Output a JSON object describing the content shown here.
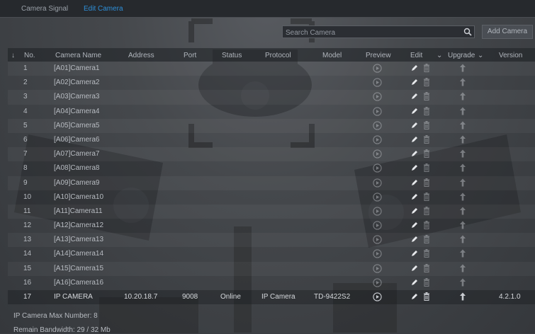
{
  "tabs": [
    {
      "label": "Camera Signal",
      "active": false
    },
    {
      "label": "Edit Camera",
      "active": true
    }
  ],
  "search": {
    "placeholder": "Search Camera"
  },
  "add_button": "Add Camera",
  "columns": {
    "sort": "↓",
    "no": "No.",
    "name": "Camera Name",
    "address": "Address",
    "port": "Port",
    "status": "Status",
    "protocol": "Protocol",
    "model": "Model",
    "preview": "Preview",
    "edit": "Edit",
    "upgrade": "Upgrade",
    "version": "Version"
  },
  "rows": [
    {
      "no": "1",
      "name": "[A01]Camera1"
    },
    {
      "no": "2",
      "name": "[A02]Camera2"
    },
    {
      "no": "3",
      "name": "[A03]Camera3"
    },
    {
      "no": "4",
      "name": "[A04]Camera4"
    },
    {
      "no": "5",
      "name": "[A05]Camera5"
    },
    {
      "no": "6",
      "name": "[A06]Camera6"
    },
    {
      "no": "7",
      "name": "[A07]Camera7"
    },
    {
      "no": "8",
      "name": "[A08]Camera8"
    },
    {
      "no": "9",
      "name": "[A09]Camera9"
    },
    {
      "no": "10",
      "name": "[A10]Camera10"
    },
    {
      "no": "11",
      "name": "[A11]Camera11"
    },
    {
      "no": "12",
      "name": "[A12]Camera12"
    },
    {
      "no": "13",
      "name": "[A13]Camera13"
    },
    {
      "no": "14",
      "name": "[A14]Camera14"
    },
    {
      "no": "15",
      "name": "[A15]Camera15"
    },
    {
      "no": "16",
      "name": "[A16]Camera16"
    },
    {
      "no": "17",
      "name": "IP CAMERA",
      "address": "10.20.18.7",
      "port": "9008",
      "status": "Online",
      "protocol": "IP Camera",
      "model": "TD-9422S2",
      "version": "4.2.1.0"
    }
  ],
  "footer": {
    "max_number": "IP Camera Max Number: 8",
    "bandwidth": "Remain Bandwidth: 29 / 32 Mb"
  },
  "colors": {
    "accent": "#2e8fd8",
    "online": "#3bd14a"
  }
}
